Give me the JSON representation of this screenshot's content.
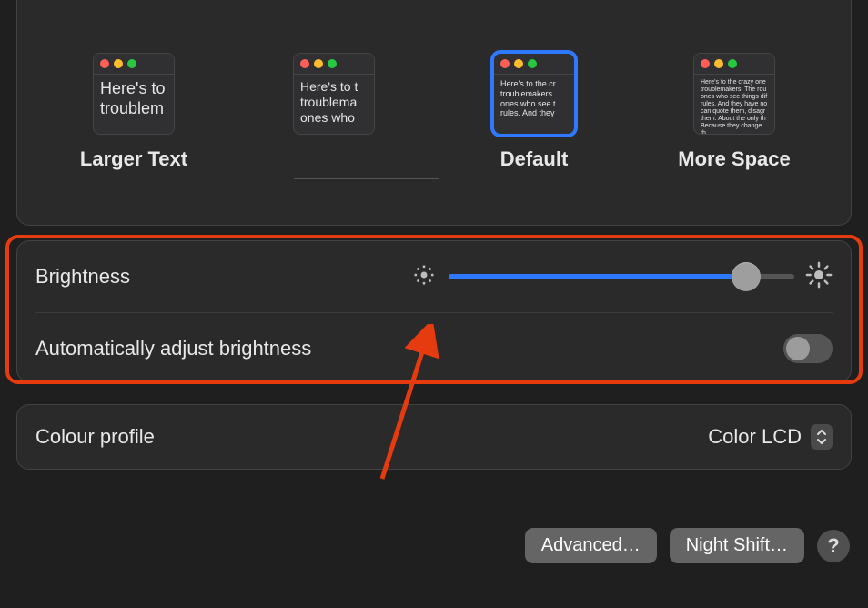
{
  "resolution": {
    "options": [
      {
        "label": "Larger Text",
        "sample": "Here's to\ntroublem"
      },
      {
        "label": "",
        "sample": "Here's to t\ntroublema\nones who"
      },
      {
        "label": "Default",
        "sample": "Here's to the cr\ntroublemakers.\nones who see t\nrules. And they"
      },
      {
        "label": "More Space",
        "sample": "Here's to the crazy one troublemakers. The rou ones who see things dif rules. And they have no can quote them, disagr them. About the only th Because they change th"
      }
    ],
    "selected_index": 2
  },
  "brightness": {
    "label": "Brightness",
    "value_percent": 86,
    "auto_label": "Automatically adjust brightness",
    "auto_on": false,
    "min_icon": "brightness-low-icon",
    "max_icon": "brightness-high-icon"
  },
  "colour_profile": {
    "label": "Colour profile",
    "value": "Color LCD"
  },
  "buttons": {
    "advanced": "Advanced…",
    "night_shift": "Night Shift…",
    "help": "?"
  },
  "annotation": {
    "highlight": "brightness-section",
    "arrow_color": "#e63a0f"
  }
}
